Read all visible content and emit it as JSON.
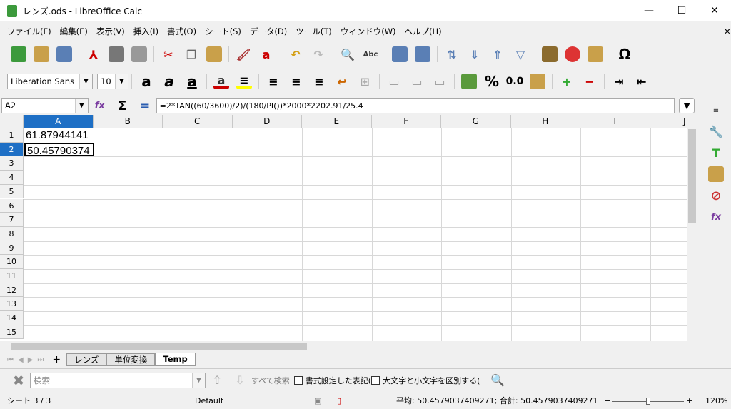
{
  "window": {
    "title": "レンズ.ods - LibreOffice Calc",
    "minimize": "—",
    "maximize": "☐",
    "close": "✕",
    "doc_close": "✕"
  },
  "menu": [
    "ファイル(F)",
    "編集(E)",
    "表示(V)",
    "挿入(I)",
    "書式(O)",
    "シート(S)",
    "データ(D)",
    "ツール(T)",
    "ウィンドウ(W)",
    "ヘルプ(H)"
  ],
  "format": {
    "font_name": "Liberation Sans",
    "font_size": "10",
    "percent": "%",
    "number": "0.0",
    "omega": "Ω"
  },
  "formula_bar": {
    "name_box": "A2",
    "formula": "=2*TAN((60/3600)/2)/(180/PI())*2000*2202.91/25.4"
  },
  "columns": [
    "A",
    "B",
    "C",
    "D",
    "E",
    "F",
    "G",
    "H",
    "I",
    "J"
  ],
  "rows": [
    "1",
    "2",
    "3",
    "4",
    "5",
    "6",
    "7",
    "8",
    "9",
    "10",
    "11",
    "12",
    "13",
    "14",
    "15"
  ],
  "cells": {
    "A1": "61.87944141",
    "A2": "50.45790374"
  },
  "sheet_tabs": {
    "add": "+",
    "tabs": [
      "レンズ",
      "単位変換",
      "Temp"
    ]
  },
  "find_bar": {
    "placeholder": "検索",
    "find_all": "すべて検索",
    "formatted_display": "書式設定した表記(",
    "match_case": "大文字と小文字を区別する("
  },
  "status_bar": {
    "sheet": "シート 3 / 3",
    "page_style": "Default",
    "summary": "平均: 50.4579037409271; 合計: 50.4579037409271",
    "zoom": "120%",
    "zoom_minus": "−",
    "zoom_plus": "+"
  }
}
